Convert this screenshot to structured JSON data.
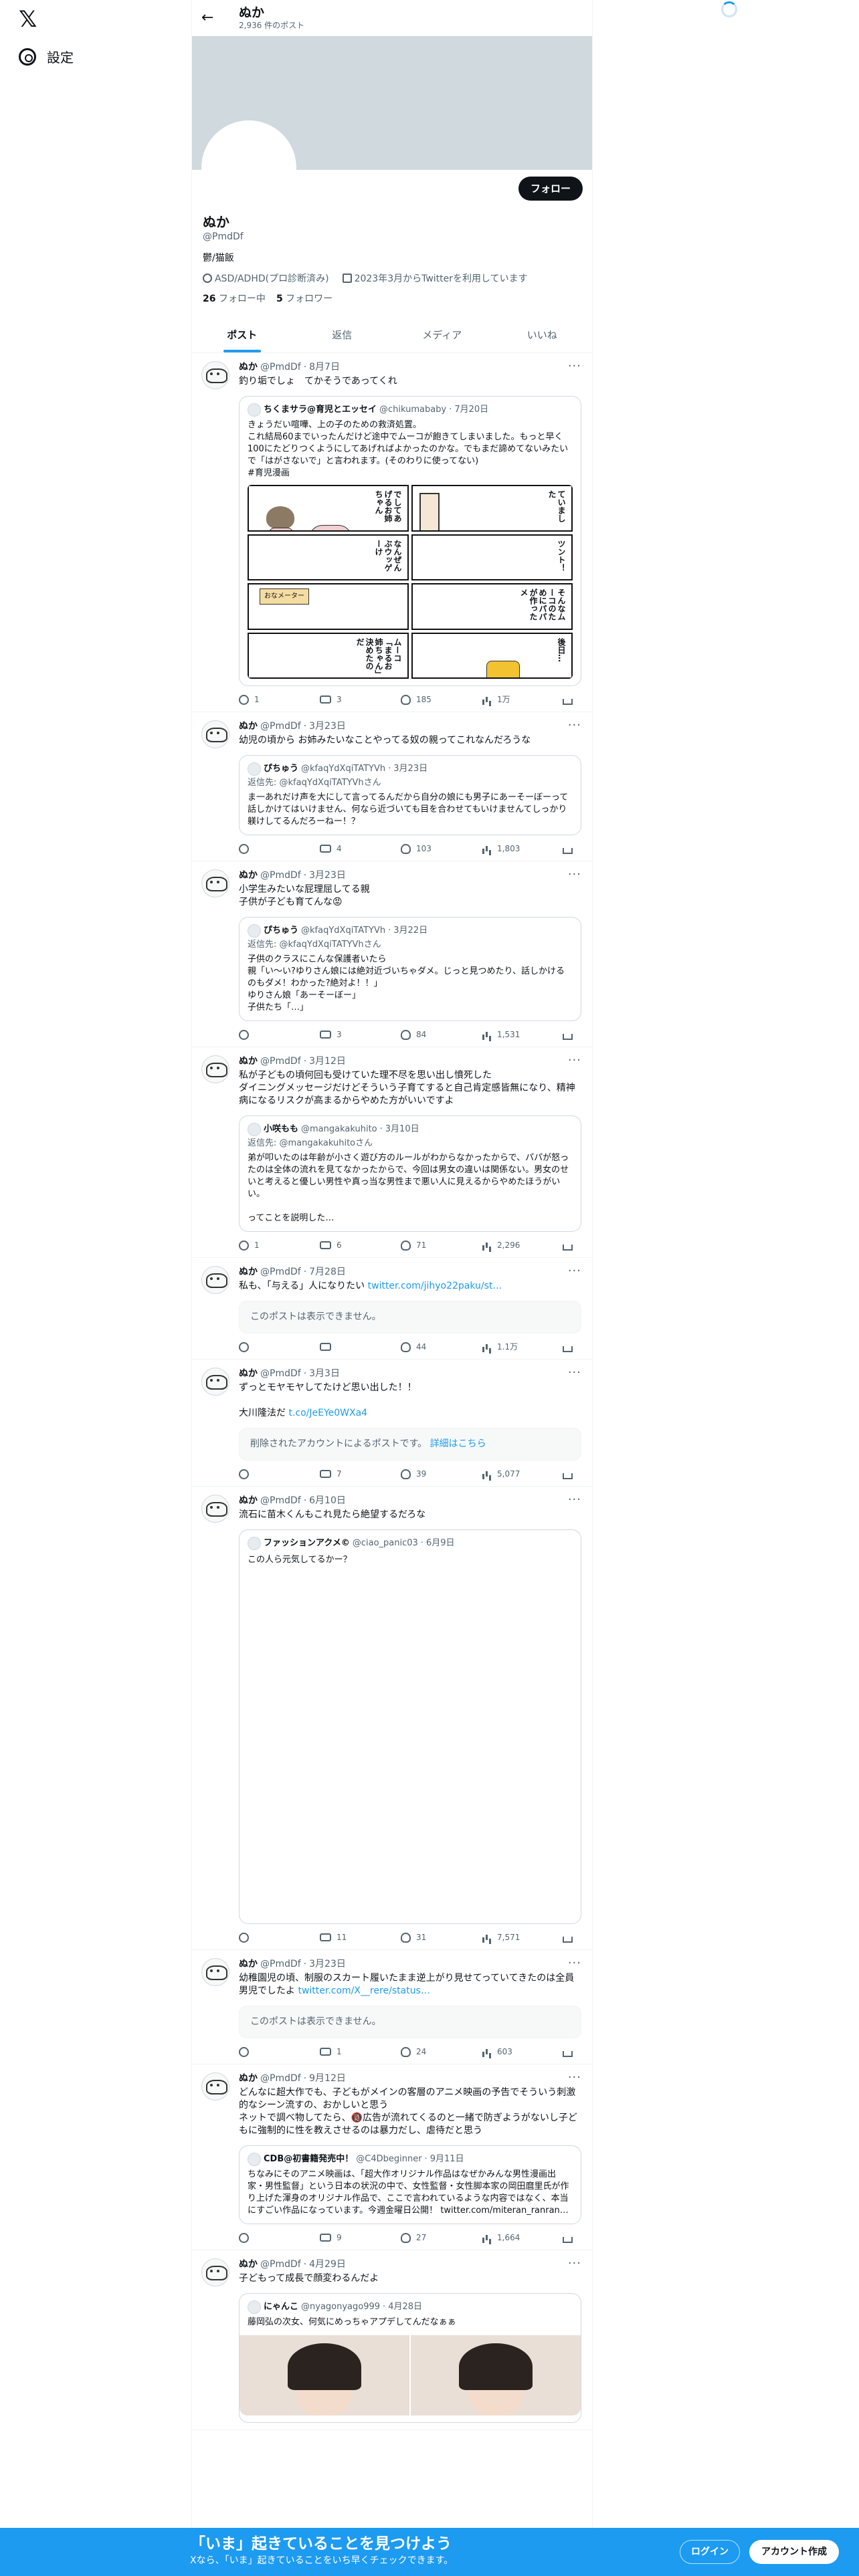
{
  "nav": {
    "logo": "𝕏",
    "settings_label": "設定"
  },
  "profile": {
    "header_name": "ぬか",
    "post_count": "2,936 件のポスト",
    "follow_label": "フォロー",
    "name": "ぬか",
    "handle": "@PmdDf",
    "bio": "鬱/猫飯",
    "location": "ASD/ADHD(プロ診断済み)",
    "joined": "2023年3月からTwitterを利用しています",
    "following_count": "26",
    "following_label": "フォロー中",
    "followers_count": "5",
    "followers_label": "フォロワー"
  },
  "tabs": [
    "ポスト",
    "返信",
    "メディア",
    "いいね"
  ],
  "tweets": [
    {
      "name": "ぬか",
      "handle": "@PmdDf",
      "date": "8月7日",
      "text": "釣り垢でしょ　てかそうであってくれ",
      "quote": {
        "name": "ちくまサラ@育児とエッセイ",
        "handle": "@chikumababy",
        "date": "7月20日",
        "reply_to": "",
        "text": "きょうだい喧嘩、上の子のための救済処置。\nこれ結局60までいったんだけど途中でムーコが飽きてしまいました。もっと早く100にたどりつくようにしてあげればよかったのかな。でもまだ諦めてないみたいで「はがさないで」と言われます。(そのわりに使ってない)\n#育児漫画"
      },
      "comic": [
        "でしてあげるお姉ちゃん",
        "ていました",
        "なんぜんぶウッゲーけ",
        "ツント！",
        "おなメーター",
        "そんなムーコのためにパパが作ったメ",
        "ムーコ「まるお姉ちゃん」決めたのだ",
        "後日…"
      ],
      "stats": {
        "reply": "1",
        "retweet": "3",
        "like": "185",
        "view": "1万"
      }
    },
    {
      "name": "ぬか",
      "handle": "@PmdDf",
      "date": "3月23日",
      "text": "幼児の頃から お姉みたいなことやってる奴の親ってこれなんだろうな",
      "quote": {
        "name": "ぴちゅう",
        "handle": "@kfaqYdXqiTATYVh",
        "date": "3月23日",
        "reply_to": "返信先: @kfaqYdXqiTATYVhさん",
        "text": "ま一あれだけ声を大にして言ってるんだから自分の娘にも男子にあーそーぼーって話しかけてはいけません、何なら近づいても目を合わせてもいけませんてしっかり躾けしてるんだろーねー！？"
      },
      "stats": {
        "reply": "",
        "retweet": "4",
        "like": "103",
        "view": "1,803"
      }
    },
    {
      "name": "ぬか",
      "handle": "@PmdDf",
      "date": "3月23日",
      "text": "小学生みたいな屁理屈してる親\n子供が子ども育てんな😡",
      "quote": {
        "name": "ぴちゅう",
        "handle": "@kfaqYdXqiTATYVh",
        "date": "3月22日",
        "reply_to": "返信先: @kfaqYdXqiTATYVhさん",
        "text": "子供のクラスにこんな保護者いたら\n親「い〜い?ゆりさん娘には絶対近づいちゃダメ。じっと見つめたり、話しかけるのもダメ！わかった?絶対よ！！」\nゆりさん娘「あーそーぼー」\n子供たち「…」"
      },
      "stats": {
        "reply": "",
        "retweet": "3",
        "like": "84",
        "view": "1,531"
      }
    },
    {
      "name": "ぬか",
      "handle": "@PmdDf",
      "date": "3月12日",
      "text": "私が子どもの頃何回も受けていた理不尽を思い出し憤死した\nダイニングメッセージだけどそういう子育てすると自己肯定感皆無になり、精神病になるリスクが高まるからやめた方がいいですよ",
      "quote": {
        "name": "小咲もも",
        "handle": "@mangakakuhito",
        "date": "3月10日",
        "reply_to": "返信先: @mangakakuhitoさん",
        "text": "弟が叩いたのは年齢が小さく遊び方のルールがわからなかったからで、パパが怒ったのは全体の流れを見てなかったからで、今回は男女の違いは関係ない。男女のせいと考えると優しい男性や真っ当な男性まで悪い人に見えるからやめたほうがいい。\n\nってことを説明した…"
      },
      "stats": {
        "reply": "1",
        "retweet": "6",
        "like": "71",
        "view": "2,296"
      }
    },
    {
      "name": "ぬか",
      "handle": "@PmdDf",
      "date": "7月28日",
      "text": "私も、「与える」人になりたい",
      "link": "twitter.com/jihyo22paku/st…",
      "unavailable": "このポストは表示できません。",
      "stats": {
        "reply": "",
        "retweet": "",
        "like": "44",
        "view": "1.1万"
      }
    },
    {
      "name": "ぬか",
      "handle": "@PmdDf",
      "date": "3月3日",
      "text": "ずっとモヤモヤしてたけど思い出した！！\n\n大川隆法だ",
      "link": "t.co/JeEYe0WXa4",
      "unavailable": "削除されたアカウントによるポストです。",
      "unavailable_link": "詳細はこちら",
      "stats": {
        "reply": "",
        "retweet": "7",
        "like": "39",
        "view": "5,077"
      }
    },
    {
      "name": "ぬか",
      "handle": "@PmdDf",
      "date": "6月10日",
      "text": "流石に苗木くんもこれ見たら絶望するだろな",
      "quote": {
        "name": "ファッションアクメ©",
        "handle": "@ciao_panic03",
        "date": "6月9日",
        "reply_to": "",
        "text": "この人ら元気してるかー？"
      },
      "stats": {
        "reply": "",
        "retweet": "11",
        "like": "31",
        "view": "7,571"
      }
    },
    {
      "name": "ぬか",
      "handle": "@PmdDf",
      "date": "3月23日",
      "text": "幼稚園児の頃、制服のスカート履いたまま逆上がり見せてっていてきたのは全員男児でしたよ",
      "link": "twitter.com/X__rere/status…",
      "unavailable": "このポストは表示できません。",
      "stats": {
        "reply": "",
        "retweet": "1",
        "like": "24",
        "view": "603"
      }
    },
    {
      "name": "ぬか",
      "handle": "@PmdDf",
      "date": "9月12日",
      "text": "どんなに超大作でも、子どもがメインの客層のアニメ映画の予告でそういう刺激的なシーン流すの、おかしいと思う\nネットで調べ物してたら、🔞広告が流れてくるのと一緒で防ぎようがないし子どもに強制的に性を教えさせるのは暴力だし、虐待だと思う",
      "quote": {
        "name": "CDB@初書籍発売中！",
        "handle": "@C4Dbeginner",
        "date": "9月11日",
        "reply_to": "",
        "text": "ちなみにそのアニメ映画は、「超大作オリジナル作品はなぜかみんな男性漫画出家・男性監督」という日本の状況の中で、女性監督・女性脚本家の岡田麿里氏が作り上げた渾身のオリジナル作品で、ここで言われているような内容ではなく、本当にすごい作品になっています。今週金曜日公開！ twitter.com/miteran_ranran…"
      },
      "stats": {
        "reply": "",
        "retweet": "9",
        "like": "27",
        "view": "1,664"
      }
    },
    {
      "name": "ぬか",
      "handle": "@PmdDf",
      "date": "4月29日",
      "text": "子どもって成長で顔変わるんだよ",
      "quote": {
        "name": "にゃんこ",
        "handle": "@nyagonyago999",
        "date": "4月28日",
        "reply_to": "",
        "text": "藤岡弘の次女、何気にめっちゃアプデしてんだなぁぁ"
      },
      "stats": {
        "reply": "",
        "retweet": "",
        "like": "",
        "view": ""
      }
    }
  ],
  "bottom_bar": {
    "title": "「いま」起きていることを見つけよう",
    "subtitle": "Xなら、「いま」起きていることをいち早くチェックできます。",
    "login": "ログイン",
    "signup": "アカウント作成"
  }
}
